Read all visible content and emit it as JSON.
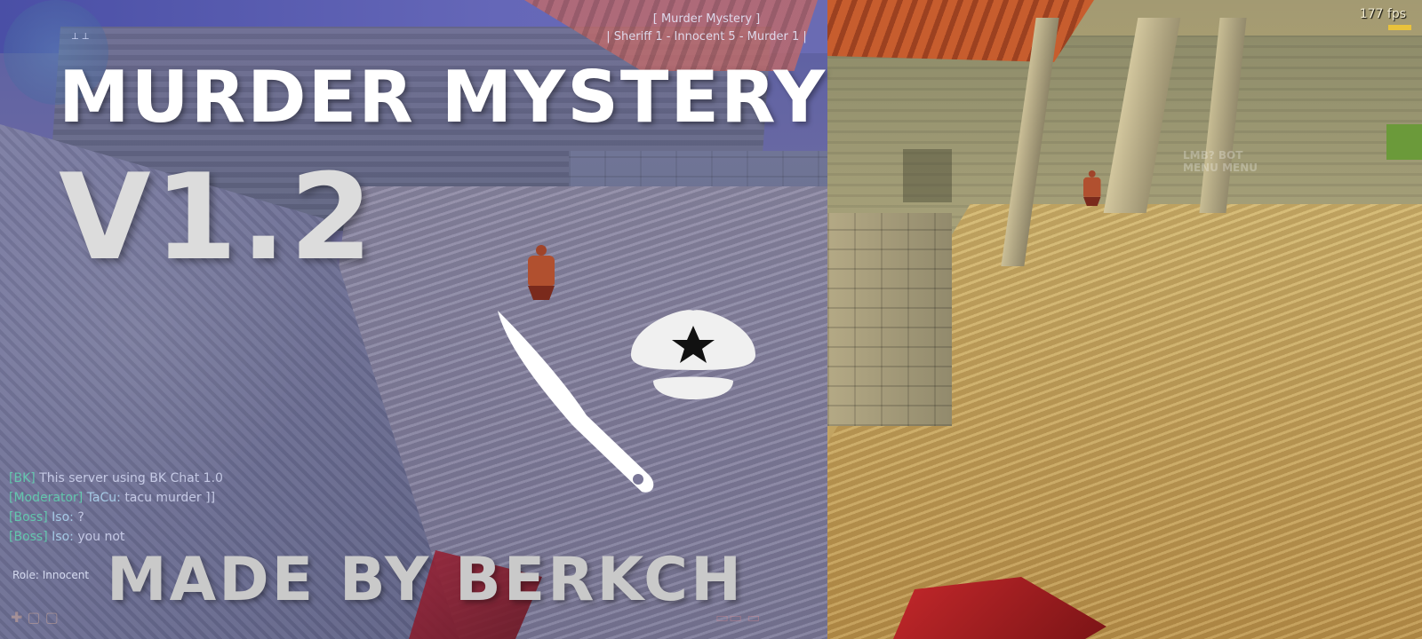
{
  "title": "MURDER MYSTERY",
  "version": "V1.2",
  "credit": "MADE BY BERKCH",
  "hud": {
    "mode_label": "[ Murder Mystery ]",
    "team_counts": "| Sheriff 1 - Innocent 5 - Murder 1 |",
    "fps": "177 fps",
    "role": "Role: Innocent",
    "watermark_text": "LMB? BOT\nMENU MENU"
  },
  "chat": [
    {
      "tag": "[BK]",
      "name": "",
      "message": "This server using BK Chat 1.0"
    },
    {
      "tag": "[Moderator]",
      "name": "TaCu:",
      "message": "tacu murder ]]"
    },
    {
      "tag": "[Boss]",
      "name": "Iso:",
      "message": "?"
    },
    {
      "tag": "[Boss]",
      "name": "Iso:",
      "message": "you not"
    }
  ],
  "icons": [
    "knife-icon",
    "sheriff-cap-icon",
    "star-icon",
    "radar-icon"
  ],
  "colors": {
    "title": "#ffffff",
    "version": "#dcdcdc",
    "credit": "#c9c9c9",
    "chat_tag": "#5fe3b5",
    "left_tint": "#6b6aa3",
    "right_sand": "#c4a765"
  }
}
